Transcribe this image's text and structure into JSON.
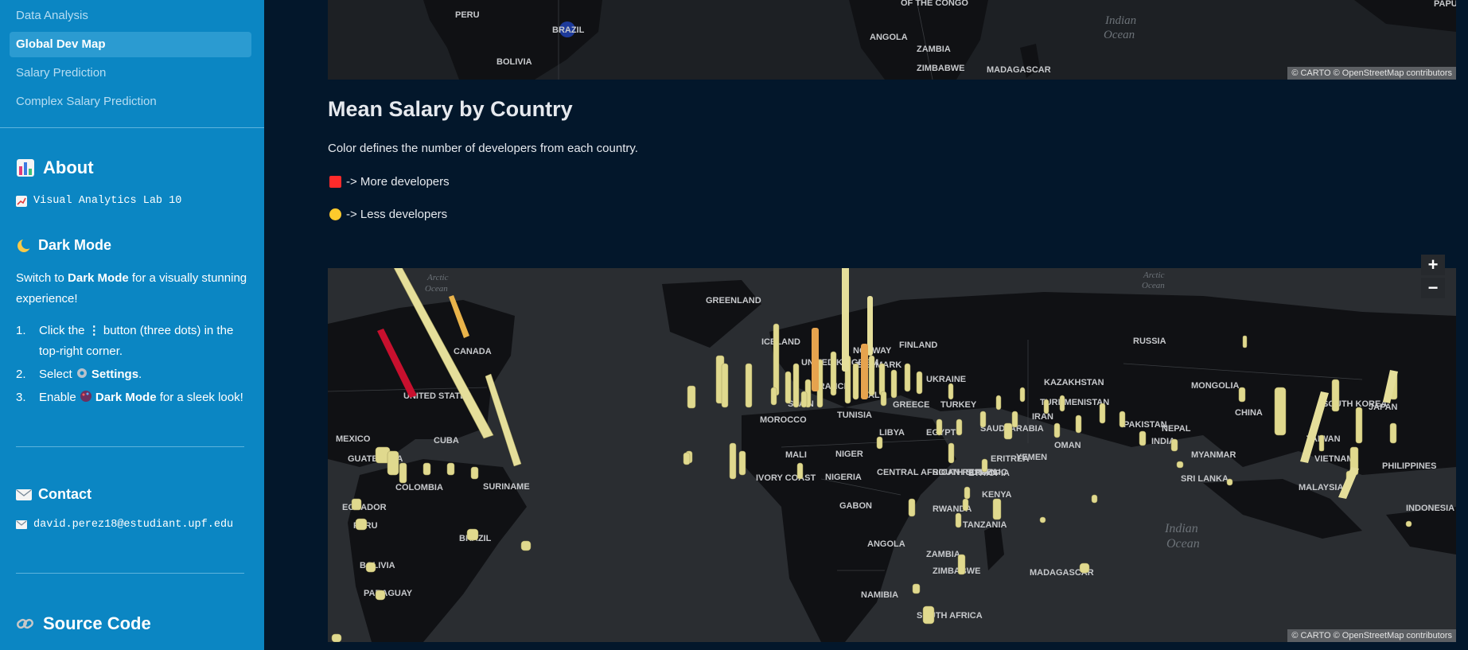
{
  "sidebar": {
    "nav": [
      {
        "label": "Data Analysis",
        "active": false
      },
      {
        "label": "Global Dev Map",
        "active": true
      },
      {
        "label": "Salary Prediction",
        "active": false
      },
      {
        "label": "Complex Salary Prediction",
        "active": false
      }
    ],
    "about": {
      "heading": "About",
      "line": "Visual Analytics Lab 10"
    },
    "dark_mode": {
      "heading": "Dark Mode",
      "intro_pre": "Switch to ",
      "intro_bold": "Dark Mode",
      "intro_post": " for a visually stunning experience!",
      "steps": [
        {
          "num": "1.",
          "pre": "Click the ",
          "bold": "⋮",
          "post": " button (three dots) in the top-right corner."
        },
        {
          "num": "2.",
          "pre": "Select ",
          "bold": "Settings",
          "post": "."
        },
        {
          "num": "3.",
          "pre": "Enable ",
          "bold": "Dark Mode",
          "post": " for a sleek look!"
        }
      ]
    },
    "contact": {
      "heading": "Contact",
      "email": "david.perez18@estudiant.upf.edu"
    },
    "source": {
      "heading": "Source Code"
    }
  },
  "top_map": {
    "labels": [
      "PERU",
      "BRAZIL",
      "BOLIVIA",
      "OF THE CONGO",
      "ANGOLA",
      "ZAMBIA",
      "ZIMBABWE",
      "MADAGASCAR",
      "PAPU"
    ],
    "ocean": [
      "Indian",
      "Ocean"
    ],
    "attribution": "© CARTO  © OpenStreetMap contributors"
  },
  "section": {
    "title": "Mean Salary by Country",
    "description": "Color defines the number of developers from each country.",
    "legend": [
      {
        "label": "-> More developers",
        "color": "#ff2b2b",
        "shape": "square"
      },
      {
        "label": "-> Less developers",
        "color": "#fdca2c",
        "shape": "circle"
      }
    ]
  },
  "main_map": {
    "zoom_in": "+",
    "zoom_out": "−",
    "attribution": "© CARTO  © OpenStreetMap contributors",
    "labels": [
      "GREENLAND",
      "ICELAND",
      "UNITED KINGDOM",
      "NORWAY",
      "FINLAND",
      "DENMARK",
      "FRANCE",
      "SPAIN",
      "ITALY",
      "GREECE",
      "UKRAINE",
      "TURKEY",
      "RUSSIA",
      "KAZAKHSTAN",
      "MONGOLIA",
      "TURKMENISTAN",
      "CHINA",
      "SOUTH KOREA",
      "JAPAN",
      "CANADA",
      "UNITED STATES",
      "MEXICO",
      "CUBA",
      "GUATEMALA",
      "COLOMBIA",
      "SURINAME",
      "ECUADOR",
      "PERU",
      "BRAZIL",
      "BOLIVIA",
      "PARAGUAY",
      "MOROCCO",
      "TUNISIA",
      "LIBYA",
      "EGYPT",
      "SAUDI ARABIA",
      "IRAN",
      "PAKISTAN",
      "NEPAL",
      "INDIA",
      "MYANMAR",
      "TAIWAN",
      "PHILIPPINES",
      "MALAYSIA",
      "VIETNAM",
      "INDONESIA",
      "SRI LANKA",
      "OMAN",
      "YEMEN",
      "ERITREA",
      "ETHIOPIA",
      "KENYA",
      "RWANDA",
      "TANZANIA",
      "SOUTH SUDAN",
      "CENTRAL AFRICAN REPUBLIC",
      "NIGERIA",
      "NIGER",
      "MALI",
      "IVORY COAST",
      "GABON",
      "ANGOLA",
      "ZAMBIA",
      "ZIMBABWE",
      "NAMIBIA",
      "SOUTH AFRICA",
      "MADAGASCAR"
    ],
    "oceans": [
      [
        "Arctic",
        "Ocean"
      ],
      [
        "Arctic",
        "Ocean"
      ],
      [
        "Indian",
        "Ocean"
      ]
    ]
  }
}
